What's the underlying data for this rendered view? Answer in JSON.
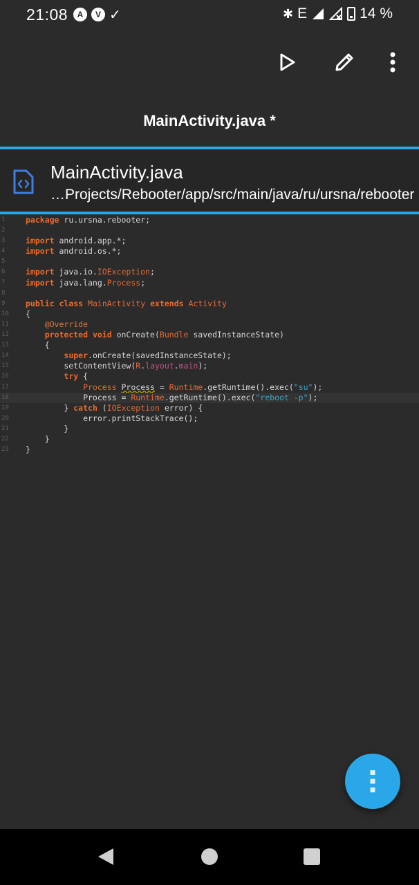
{
  "status_bar": {
    "time": "21:08",
    "left_icons": [
      "A",
      "V"
    ],
    "network": "E",
    "battery": "14 %"
  },
  "toolbar": {
    "icons": [
      "play-icon",
      "pencil-icon",
      "more-vert-icon"
    ],
    "title": "MainActivity.java *"
  },
  "file": {
    "name": "MainActivity.java",
    "path": "…Projects/Rebooter/app/src/main/java/ru/ursna/rebooter"
  },
  "colors": {
    "accent": "#2aa7e8",
    "keyword": "#ee6a2a",
    "string": "#3da6c4",
    "field": "#c8508a",
    "background": "#2b2b2b"
  },
  "editor": {
    "active_line": 18,
    "lines": [
      "package ru.ursna.rebooter;",
      "",
      "import android.app.*;",
      "import android.os.*;",
      "",
      "import java.io.IOException;",
      "import java.lang.Process;",
      "",
      "public class MainActivity extends Activity",
      "{",
      "    @Override",
      "    protected void onCreate(Bundle savedInstanceState)",
      "    {",
      "        super.onCreate(savedInstanceState);",
      "        setContentView(R.layout.main);",
      "        try {",
      "            Process Process = Runtime.getRuntime().exec(\"su\");",
      "            Process = Runtime.getRuntime().exec(\"reboot -p\");",
      "        } catch (IOException error) {",
      "            error.printStackTrace();",
      "        }",
      "    }",
      "}"
    ]
  },
  "fab": {
    "icon": "more-vert-icon"
  },
  "nav_bar": {
    "icons": [
      "back-icon",
      "home-icon",
      "recents-icon"
    ]
  }
}
